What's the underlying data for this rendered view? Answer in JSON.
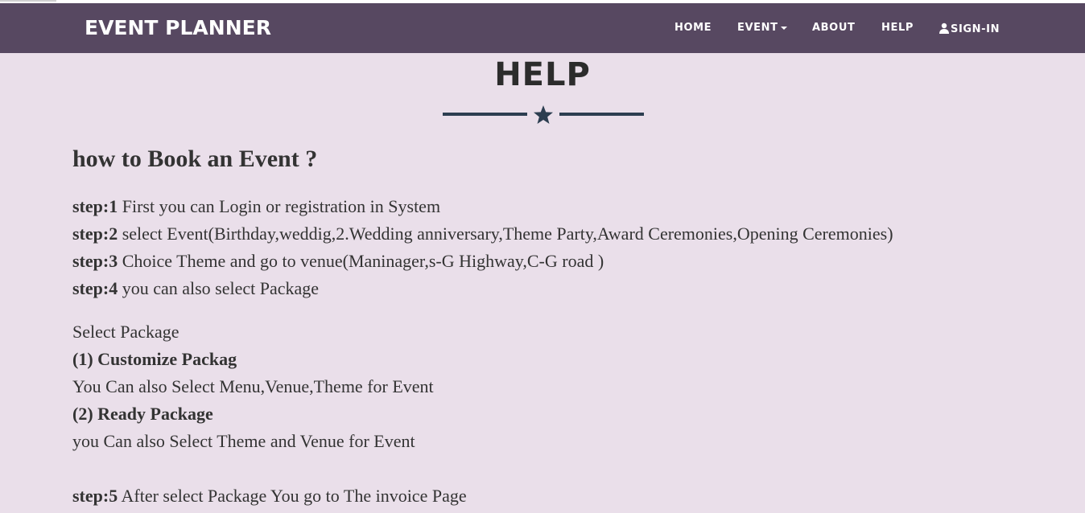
{
  "navbar": {
    "brand": "EVENT PLANNER",
    "links": {
      "home": "HOME",
      "event": "EVENT",
      "about": "ABOUT",
      "help": "HELP",
      "signin": "SIGN-IN"
    },
    "background_color": "#574861"
  },
  "page": {
    "title": "HELP",
    "background_color": "#eadfea",
    "divider_icon": "star-icon"
  },
  "content": {
    "heading": "how to Book an Event ?",
    "steps": [
      {
        "label": "step:1",
        "text": " First you can Login or registration in System"
      },
      {
        "label": "step:2",
        "text": " select Event(Birthday,weddig,2.Wedding anniversary,Theme Party,Award Ceremonies,Opening Ceremonies)"
      },
      {
        "label": "step:3",
        "text": " Choice Theme and go to venue(Maninager,s-G Highway,C-G road )"
      },
      {
        "label": "step:4",
        "text": " you can also select Package"
      }
    ],
    "packages": {
      "intro": "Select Package",
      "customize_title": "(1) Customize Packag",
      "customize_text": "You Can also Select Menu,Venue,Theme for Event",
      "ready_title": "(2) Ready Package",
      "ready_text": "you Can also Select Theme and Venue for Event"
    },
    "step5": {
      "label": "step:5",
      "text": " After select Package You go to The invoice Page"
    }
  }
}
